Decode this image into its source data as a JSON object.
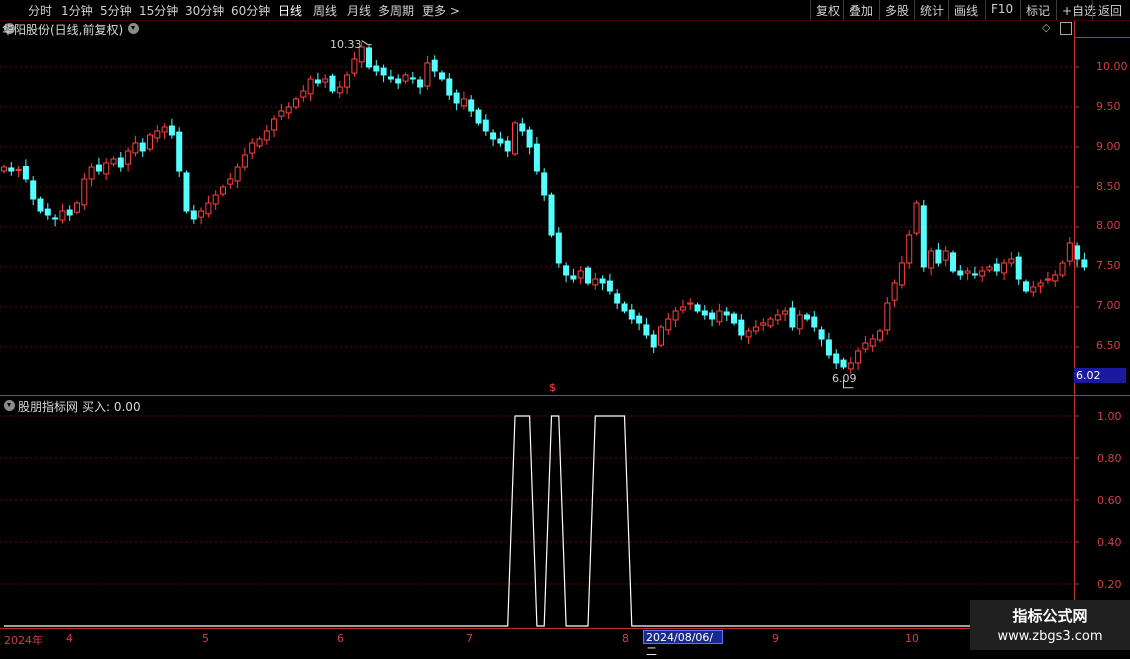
{
  "toolbar": {
    "periods": [
      "分时",
      "1分钟",
      "5分钟",
      "15分钟",
      "30分钟",
      "60分钟",
      "日线",
      "周线",
      "月线",
      "多周期",
      "更多 >"
    ],
    "active_period": "日线",
    "actions": [
      "复权",
      "叠加",
      "多股",
      "统计",
      "画线",
      "F10",
      "标记",
      "+自选",
      "返回"
    ]
  },
  "price_panel": {
    "title": "华阳股份(日线,前复权)",
    "high_label": "10.33",
    "low_label": "6.09",
    "current_price": "6.02",
    "signal_marker": "$",
    "y_ticks": [
      "10.00",
      "9.50",
      "9.00",
      "8.50",
      "8.00",
      "7.50",
      "7.00",
      "6.50"
    ],
    "colors": {
      "up": "#ff4040",
      "down": "#54ffff",
      "grid": "#7a0000",
      "axis": "#c03030"
    }
  },
  "indicator_panel": {
    "title": "股朋指标网",
    "value_label": "买入: 0.00",
    "y_ticks": [
      "1.00",
      "0.80",
      "0.60",
      "0.40",
      "0.20"
    ]
  },
  "x_axis": {
    "labels": [
      "2024年",
      "4",
      "5",
      "6",
      "7",
      "8",
      "9",
      "10"
    ],
    "cursor_date": "2024/08/06/二"
  },
  "watermark": {
    "line1": "指标公式网",
    "line2": "www.zbgs3.com"
  },
  "chart_data": {
    "type": "candlestick",
    "title": "华阳股份(日线,前复权)",
    "ylim": [
      6.0,
      10.5
    ],
    "y_ticks": [
      10.0,
      9.5,
      9.0,
      8.5,
      8.0,
      7.5,
      7.0,
      6.5
    ],
    "x_month_labels": [
      "2024年",
      "4",
      "5",
      "6",
      "7",
      "8",
      "9",
      "10"
    ],
    "annotations": {
      "high": 10.33,
      "low": 6.09,
      "last": 6.02
    },
    "closes": [
      8.75,
      8.7,
      8.72,
      8.6,
      8.35,
      8.2,
      8.15,
      8.1,
      8.2,
      8.15,
      8.3,
      8.6,
      8.75,
      8.7,
      8.8,
      8.85,
      8.75,
      8.95,
      9.05,
      8.95,
      9.15,
      9.2,
      9.25,
      9.15,
      8.7,
      8.2,
      8.1,
      8.2,
      8.3,
      8.4,
      8.5,
      8.6,
      8.75,
      8.9,
      9.05,
      9.1,
      9.2,
      9.35,
      9.45,
      9.5,
      9.6,
      9.7,
      9.85,
      9.8,
      9.85,
      9.7,
      9.75,
      9.9,
      10.1,
      10.25,
      10.0,
      9.95,
      9.9,
      9.85,
      9.8,
      9.9,
      9.85,
      9.75,
      10.05,
      9.95,
      9.85,
      9.65,
      9.55,
      9.6,
      9.45,
      9.3,
      9.2,
      9.1,
      9.05,
      8.95,
      9.3,
      9.2,
      9.0,
      8.7,
      8.4,
      7.9,
      7.55,
      7.4,
      7.35,
      7.45,
      7.3,
      7.35,
      7.3,
      7.2,
      7.05,
      6.95,
      6.85,
      6.8,
      6.65,
      6.5,
      6.75,
      6.85,
      6.95,
      7.0,
      7.05,
      6.95,
      6.9,
      6.85,
      6.95,
      6.9,
      6.8,
      6.65,
      6.7,
      6.75,
      6.8,
      6.85,
      6.9,
      6.95,
      6.75,
      6.9,
      6.85,
      6.75,
      6.6,
      6.4,
      6.3,
      6.25,
      6.3,
      6.45,
      6.55,
      6.6,
      6.7,
      7.05,
      7.3,
      7.55,
      7.9,
      8.3,
      7.5,
      7.7,
      7.55,
      7.7,
      7.45,
      7.4,
      7.45,
      7.4,
      7.45,
      7.5,
      7.45,
      7.55,
      7.6,
      7.35,
      7.2,
      7.25,
      7.3,
      7.35,
      7.4,
      7.55,
      7.8,
      7.6,
      7.5
    ],
    "indicator": {
      "name": "买入",
      "ylim": [
        0,
        1.05
      ],
      "signal_periods": [
        [
          70,
          72
        ],
        [
          75,
          76
        ],
        [
          81,
          85
        ]
      ],
      "value": 0.0
    }
  }
}
